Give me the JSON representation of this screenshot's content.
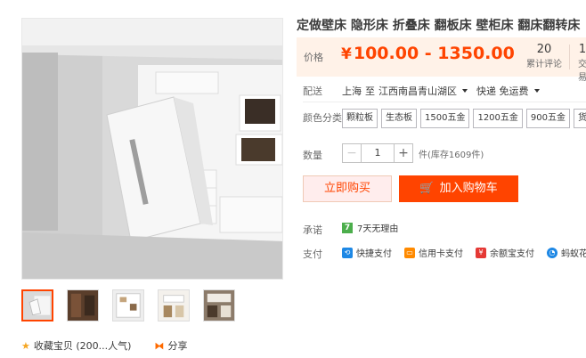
{
  "product": {
    "title": "定做壁床 隐形床 折叠床 翻板床 壁柜床 翻床翻转床"
  },
  "price": {
    "label": "价格",
    "currency": "¥",
    "range": "100.00 - 1350.00",
    "stats": [
      {
        "num": "20",
        "label": "累计评论"
      },
      {
        "num": "1",
        "label": "交易"
      }
    ]
  },
  "delivery": {
    "label": "配送",
    "from": "上海",
    "to_word": "至",
    "destination": "江西南昌青山湖区",
    "shipping": "快递 免运费"
  },
  "color": {
    "label": "颜色分类",
    "options": [
      "颗粒板",
      "生态板",
      "1500五金",
      "1200五金",
      "900五金",
      "货款"
    ]
  },
  "quantity": {
    "label": "数量",
    "minus": "−",
    "plus": "+",
    "value": "1",
    "stock": "件(库存1609件)"
  },
  "actions": {
    "buy_now": "立即购买",
    "add_cart": "加入购物车"
  },
  "promise": {
    "label": "承诺",
    "badge": "7",
    "text": "7天无理由"
  },
  "payment": {
    "label": "支付",
    "methods": [
      {
        "name": "快捷支付",
        "icon": "quick-pay-icon",
        "color": "#1e88e5"
      },
      {
        "name": "信用卡支付",
        "icon": "credit-card-icon",
        "color": "#ff8a00"
      },
      {
        "name": "余额宝支付",
        "icon": "yuebao-icon",
        "color": "#e53935"
      },
      {
        "name": "蚂蚁花呗",
        "icon": "huabei-icon",
        "color": "#1e88e5"
      }
    ]
  },
  "footer": {
    "collect": "收藏宝贝 (200...人气)",
    "share": "分享"
  },
  "colors": {
    "accent": "#ff4400",
    "price_bg": "#fff2e8"
  }
}
